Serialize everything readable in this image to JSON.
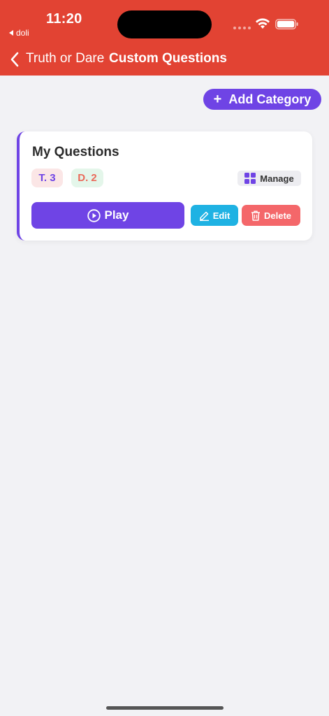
{
  "status_bar": {
    "time": "11:20",
    "back_app": "doli"
  },
  "nav": {
    "back_label": "Truth or Dare",
    "title": "Custom Questions"
  },
  "toolbar": {
    "add_category_icon": "+",
    "add_category_label": "Add Category"
  },
  "categories": [
    {
      "name": "My Questions",
      "truth_badge": "T. 3",
      "dare_badge": "D. 2",
      "manage_label": "Manage",
      "play_label": "Play",
      "edit_label": "Edit",
      "delete_label": "Delete"
    }
  ],
  "colors": {
    "header": "#e24333",
    "accent": "#6f44e5",
    "edit": "#1fb2e3",
    "delete": "#f4676a"
  },
  "icons": {
    "back": "chevron-left-icon",
    "add": "plus-icon",
    "manage": "grid-icon",
    "play": "play-circle-icon",
    "edit": "pencil-icon",
    "delete": "trash-icon"
  }
}
